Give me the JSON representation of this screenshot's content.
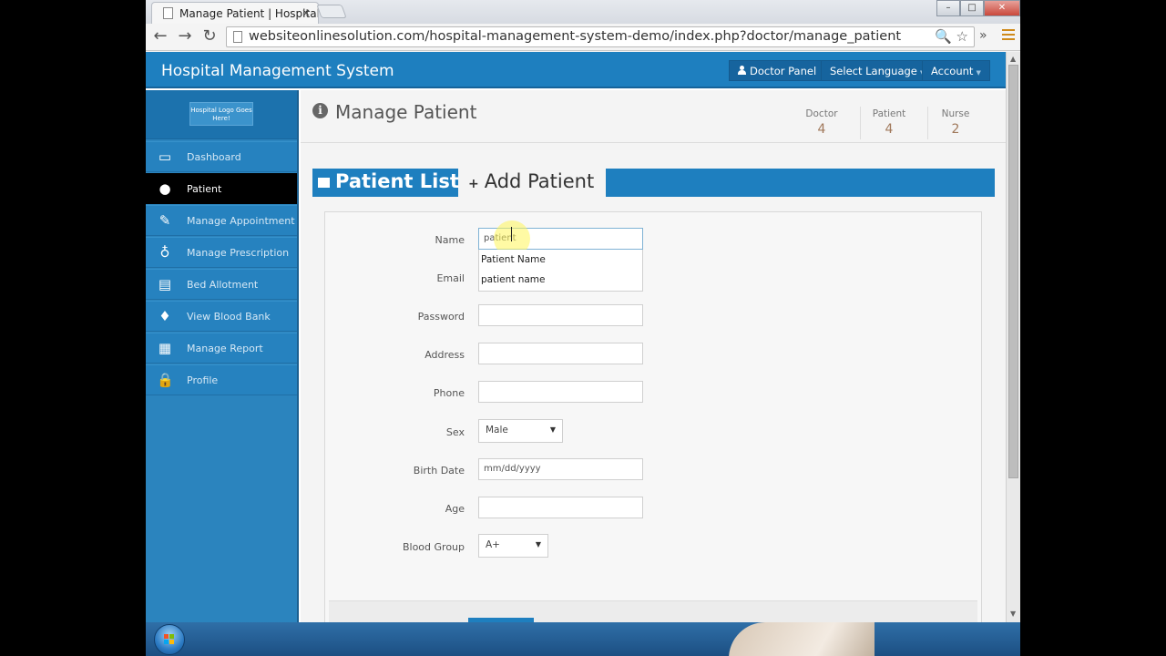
{
  "browser": {
    "tab_title": "Manage Patient | Hospital",
    "tab_close": "×",
    "url": "websiteonlinesolution.com/hospital-management-system-demo/index.php?doctor/manage_patient",
    "back": "←",
    "forward": "→",
    "reload": "↻",
    "omni_icons": "🔍 ☆",
    "extension": "»",
    "win_min": "–",
    "win_max": "□",
    "win_close": "✕"
  },
  "header": {
    "title": "Hospital Management System",
    "doctor_panel": "Doctor Panel",
    "select_language": "Select Language",
    "account": "Account",
    "caret": "▼"
  },
  "sidebar": {
    "logo_text": "Hospital Logo Goes Here!",
    "items": [
      {
        "label": "Dashboard",
        "icon": "monitor-icon",
        "glyph": "▭"
      },
      {
        "label": "Patient",
        "icon": "user-icon",
        "glyph": "●"
      },
      {
        "label": "Manage Appointment",
        "icon": "edit-icon",
        "glyph": "✎"
      },
      {
        "label": "Manage Prescription",
        "icon": "stethoscope-icon",
        "glyph": "♁"
      },
      {
        "label": "Bed Allotment",
        "icon": "hdd-icon",
        "glyph": "▤"
      },
      {
        "label": "View Blood Bank",
        "icon": "tint-icon",
        "glyph": "♦"
      },
      {
        "label": "Manage Report",
        "icon": "hospital-icon",
        "glyph": "▦"
      },
      {
        "label": "Profile",
        "icon": "lock-icon",
        "glyph": "🔒"
      }
    ],
    "active_index": 1
  },
  "main": {
    "info_glyph": "i",
    "page_title": "Manage Patient",
    "stats": [
      {
        "label": "Doctor",
        "value": "4"
      },
      {
        "label": "Patient",
        "value": "4"
      },
      {
        "label": "Nurse",
        "value": "2"
      }
    ],
    "tabs": {
      "list": "Patient List",
      "add": "Add Patient",
      "add_glyph": "+"
    },
    "form": {
      "name_label": "Name",
      "name_value": "patient",
      "email_label": "Email",
      "password_label": "Password",
      "address_label": "Address",
      "phone_label": "Phone",
      "sex_label": "Sex",
      "sex_value": "Male",
      "birth_label": "Birth Date",
      "birth_placeholder": "mm/dd/yyyy",
      "age_label": "Age",
      "blood_label": "Blood Group",
      "blood_value": "A+",
      "dd_arrow": "▼",
      "autocomplete": [
        "Patient Name",
        "patient name"
      ]
    }
  },
  "scrollbar": {
    "up": "▲",
    "down": "▼"
  },
  "colors": {
    "brand": "#1e7fbf",
    "sidebar": "#2b84be",
    "active": "#000000",
    "stat_value": "#a0785a"
  }
}
